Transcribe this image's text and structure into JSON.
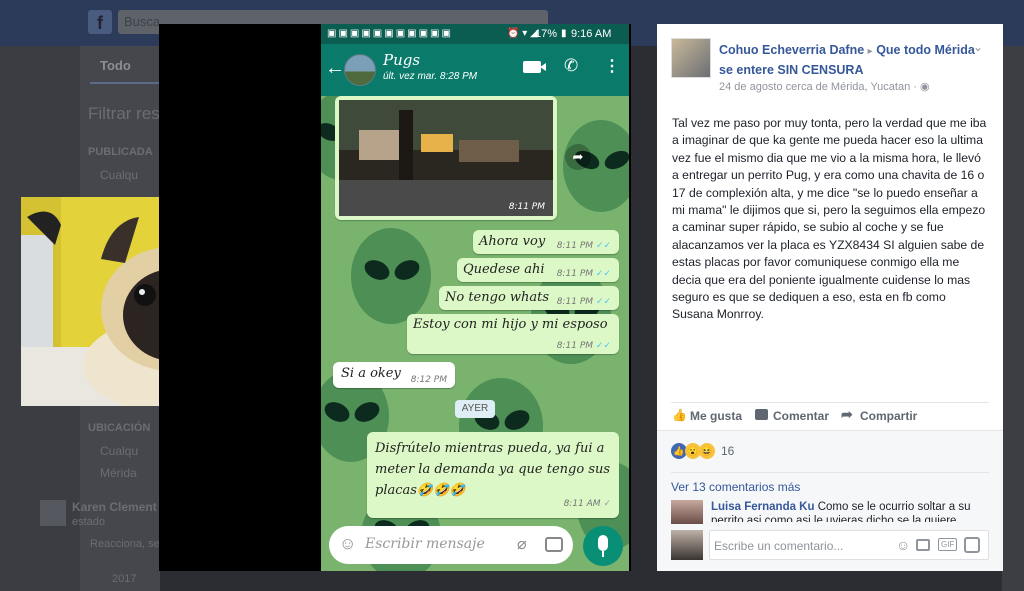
{
  "background_page": {
    "search_text": "Busca",
    "tab_all": "Todo",
    "filter_title": "Filtrar res",
    "section_published": "PUBLICADA",
    "item_published": "Cualqu",
    "section_location": "UBICACIÓN",
    "item_location_1": "Cualqu",
    "item_location_2": "Mérida",
    "friend_name": "Karen Clement",
    "friend_sub": "estado",
    "friend_sub2": "Reacciona, se",
    "year": "2017"
  },
  "phone": {
    "status": {
      "time": "9:16 AM",
      "battery": "17%"
    },
    "chat": {
      "name": "Pugs",
      "last_seen": "últ. vez mar. 8:28 PM"
    },
    "messages": [
      {
        "text": "",
        "time": "8:11 PM",
        "type": "image"
      },
      {
        "text": "Ahora voy",
        "time": "8:11 PM",
        "type": "out"
      },
      {
        "text": "Quedese ahi",
        "time": "8:11 PM",
        "type": "out"
      },
      {
        "text": "No tengo whats",
        "time": "8:11 PM",
        "type": "out"
      },
      {
        "text": "Estoy con mi hijo y mi esposo",
        "time": "8:11 PM",
        "type": "out"
      },
      {
        "text": "Si a okey",
        "time": "8:12 PM",
        "type": "in"
      },
      {
        "text": "Disfrútelo mientras pueda, ya fui a meter la demanda ya que tengo sus placas🤣🤣🤣",
        "time": "8:11 AM",
        "type": "out"
      }
    ],
    "date_chip": "AYER",
    "input_placeholder": "Escribir mensaje"
  },
  "fb_post": {
    "author": "Cohuo Echeverria Dafne",
    "arrow": "▸",
    "group": "Que todo Mérida se entere SIN CENSURA",
    "date": "24 de agosto cerca de Mérida, Yucatan",
    "body": "Tal vez me paso por muy tonta, pero la verdad que me iba a imaginar de que ka gente me pueda hacer eso la ultima vez fue el mismo dia que me vio a la misma hora, le llevó a entregar un perrito Pug, y era como una chavita de 16 o 17 de complexión alta, y me dice \"se lo puedo enseñar a mi mama\" le dijimos que si, pero la seguimos ella empezo a caminar super rápido, se subio al coche y se fue alacanzamos ver la placa es YZX8434 SI alguien sabe de estas placas por favor comuniquese conmigo ella me decia que era del poniente igualmente cuidense lo mas seguro es que se dediquen a eso, esta en fb como Susana Monrroy.",
    "like_label": "Me gusta",
    "comment_label": "Comentar",
    "share_label": "Compartir",
    "reaction_count": "16",
    "view_comments": "Ver 13 comentarios más",
    "comment_author": "Luisa Fernanda Ku",
    "comment_text": "Como se le ocurrio soltar a su perrito asi como asi le uvieras dicho se la quiere",
    "comment_placeholder": "Escribe un comentario...",
    "accent": "#365899"
  }
}
